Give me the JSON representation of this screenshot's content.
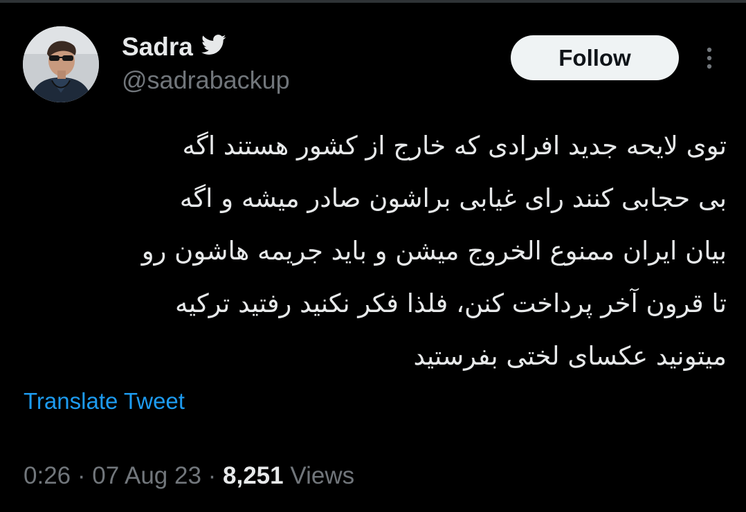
{
  "theme": {
    "background": "#000000",
    "text_primary": "#e7e9ea",
    "text_secondary": "#71767b",
    "link_color": "#1d9bf0",
    "follow_button_bg": "#eff3f4",
    "follow_button_text": "#0f1419"
  },
  "author": {
    "display_name": "Sadra",
    "badge_icon": "twitter-bird-icon",
    "handle": "@sadrabackup",
    "avatar_icon": "user-avatar-photo"
  },
  "actions": {
    "follow_label": "Follow",
    "more_icon": "more-vertical-icon"
  },
  "tweet": {
    "lines": [
      "توی لایحه جدید افرادی که خارج از کشور هستند اگه",
      "بی حجابی کنند رای غیابی براشون صادر میشه و اگه",
      "بیان ایران ممنوع الخروج میشن و باید جریمه هاشون رو",
      "تا قرون آخر پرداخت کنن، فلذا فکر نکنید رفتید ترکیه",
      "میتونید عکسای لختی بفرستید"
    ],
    "translate_label": "Translate Tweet"
  },
  "meta": {
    "time": "0:26",
    "separator": "·",
    "date": "07 Aug 23",
    "views_count": "8,251",
    "views_label": "Views"
  }
}
